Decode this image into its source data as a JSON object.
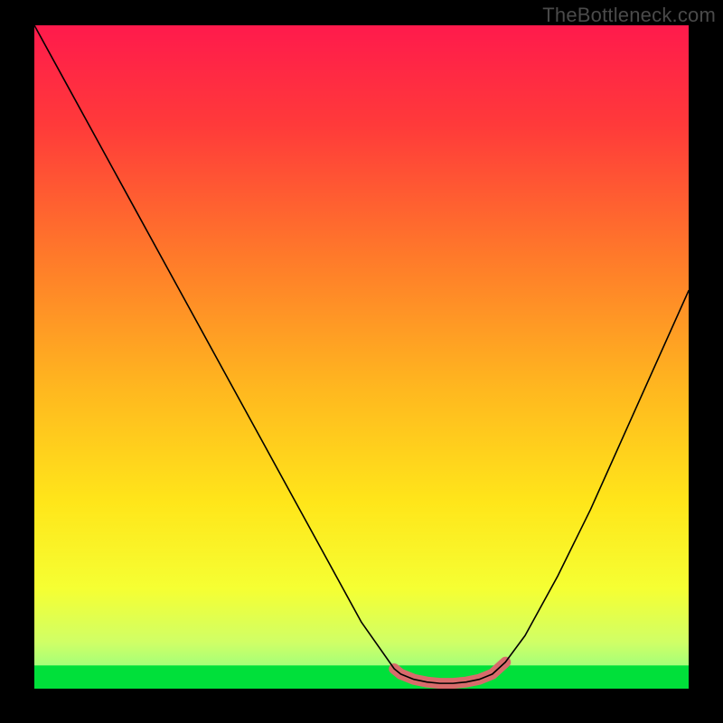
{
  "watermark": "TheBottleneck.com",
  "chart_data": {
    "type": "line",
    "title": "",
    "xlabel": "",
    "ylabel": "",
    "xlim": [
      0,
      100
    ],
    "ylim": [
      0,
      100
    ],
    "x": [
      0,
      5,
      10,
      15,
      20,
      25,
      30,
      35,
      40,
      45,
      50,
      55,
      56,
      58,
      60,
      62,
      64,
      66,
      68,
      70,
      72,
      75,
      80,
      85,
      90,
      95,
      100
    ],
    "values": [
      100,
      91,
      82,
      73,
      64,
      55,
      46,
      37,
      28,
      19,
      10,
      3,
      2.2,
      1.4,
      1.0,
      0.8,
      0.8,
      1.0,
      1.4,
      2.2,
      4,
      8,
      17,
      27,
      38,
      49,
      60
    ],
    "valley_marker": {
      "color": "#d86b6b",
      "x": [
        55,
        56,
        58,
        60,
        62,
        64,
        66,
        68,
        70,
        72
      ],
      "y": [
        3,
        2.2,
        1.4,
        1.0,
        0.8,
        0.8,
        1.0,
        1.4,
        2.2,
        4
      ]
    },
    "green_band_yrange": [
      0,
      3.5
    ],
    "gradient_stops": [
      {
        "offset": 0.0,
        "color": "#ff1a4c"
      },
      {
        "offset": 0.15,
        "color": "#ff3a3a"
      },
      {
        "offset": 0.35,
        "color": "#ff7a2a"
      },
      {
        "offset": 0.55,
        "color": "#ffb81f"
      },
      {
        "offset": 0.72,
        "color": "#ffe61a"
      },
      {
        "offset": 0.85,
        "color": "#f5ff33"
      },
      {
        "offset": 0.93,
        "color": "#d0ff66"
      },
      {
        "offset": 1.0,
        "color": "#7bff8a"
      }
    ]
  }
}
